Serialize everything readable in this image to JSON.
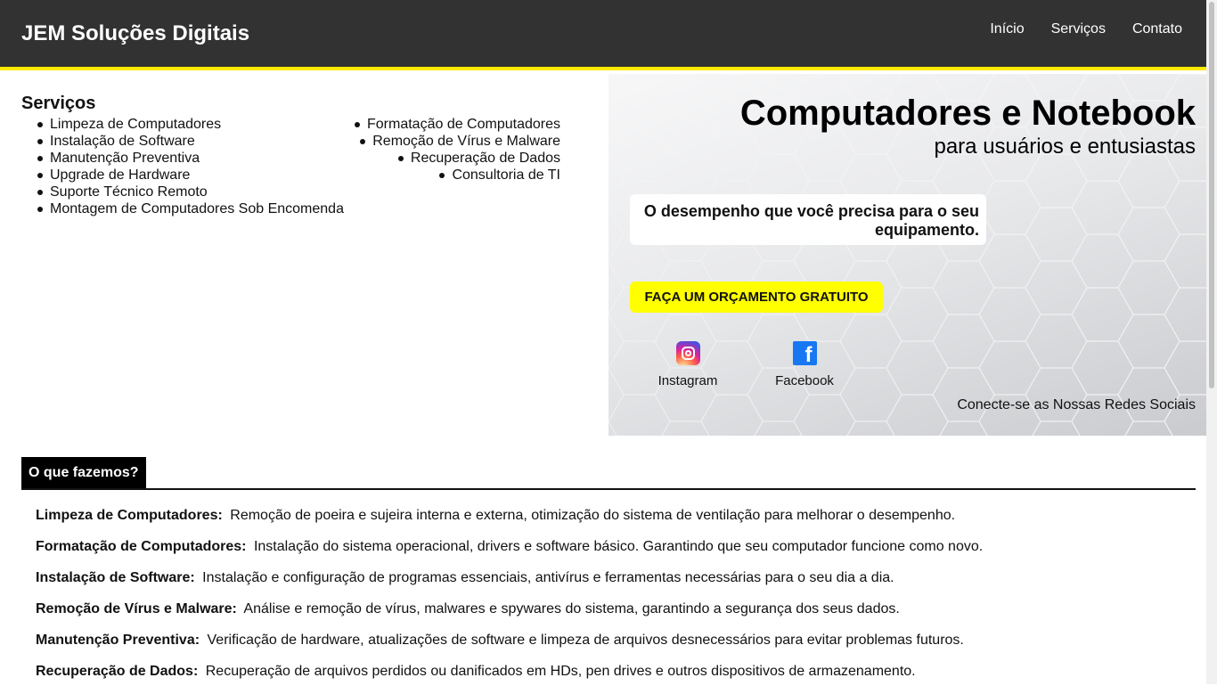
{
  "header": {
    "brand": "JEM Soluções Digitais",
    "nav": [
      "Início",
      "Serviços",
      "Contato"
    ]
  },
  "services": {
    "title": "Serviços",
    "left": [
      "Limpeza de Computadores",
      "Instalação de Software",
      "Manutenção Preventiva",
      "Upgrade de Hardware",
      "Suporte Técnico Remoto",
      "Montagem de Computadores Sob Encomenda"
    ],
    "right": [
      "Formatação de Computadores",
      "Remoção de Vírus e Malware",
      "Recuperação de Dados",
      "Consultoria de TI"
    ]
  },
  "hero": {
    "title": "Computadores e Notebook",
    "subtitle": "para usuários e entusiastas",
    "tagline": "O desempenho que você precisa para o seu equipamento.",
    "cta": "FAÇA UM ORÇAMENTO GRATUITO",
    "social": [
      {
        "label": "Instagram",
        "icon": "instagram-icon"
      },
      {
        "label": "Facebook",
        "icon": "facebook-icon"
      }
    ],
    "connect": "Conecte-se as Nossas Redes Sociais"
  },
  "what_we_do": {
    "title": "O que fazemos?",
    "items": [
      {
        "name": "Limpeza de Computadores:",
        "text": "Remoção de poeira e sujeira interna e externa, otimização do sistema de ventilação para melhorar o desempenho."
      },
      {
        "name": "Formatação de Computadores:",
        "text": "Instalação do sistema operacional, drivers e software básico. Garantindo que seu computador funcione como novo."
      },
      {
        "name": "Instalação de Software:",
        "text": "Instalação e configuração de programas essenciais, antivírus e ferramentas necessárias para o seu dia a dia."
      },
      {
        "name": "Remoção de Vírus e Malware:",
        "text": "Análise e remoção de vírus, malwares e spywares do sistema, garantindo a segurança dos seus dados."
      },
      {
        "name": "Manutenção Preventiva:",
        "text": "Verificação de hardware, atualizações de software e limpeza de arquivos desnecessários para evitar problemas futuros."
      },
      {
        "name": "Recuperação de Dados:",
        "text": "Recuperação de arquivos perdidos ou danificados em HDs, pen drives e outros dispositivos de armazenamento."
      }
    ]
  },
  "colors": {
    "header_bg": "#323232",
    "accent": "#ffea00",
    "cta_bg": "#ffff00"
  }
}
